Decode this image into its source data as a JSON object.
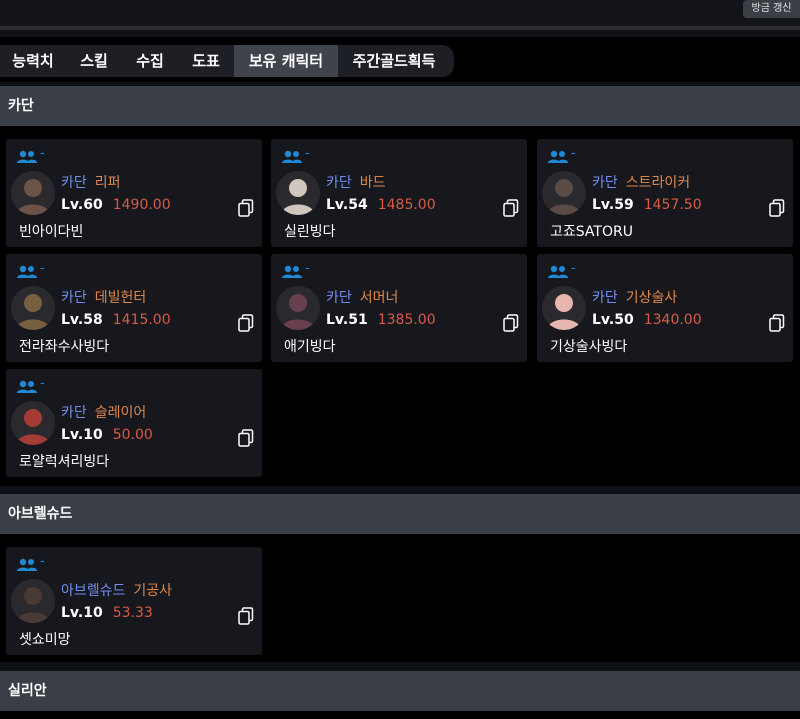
{
  "header": {
    "refresh_label": "방금 갱신"
  },
  "tabs": [
    {
      "label": "능력치",
      "active": false
    },
    {
      "label": "스킬",
      "active": false
    },
    {
      "label": "수집",
      "active": false
    },
    {
      "label": "도표",
      "active": false
    },
    {
      "label": "보유 캐릭터",
      "active": true
    },
    {
      "label": "주간골드획득",
      "active": false
    }
  ],
  "colors": {
    "server": "#6f8df0",
    "class": "#e0874a",
    "item_level": "#d85a45",
    "accent_blue": "#1e8ad6"
  },
  "sections": [
    {
      "title": "카단",
      "characters": [
        {
          "group": "-",
          "server": "카단",
          "class": "리퍼",
          "level": "Lv.60",
          "item_level": "1490.00",
          "name": "빈아이다빈",
          "avatar_color": "#6b5348"
        },
        {
          "group": "-",
          "server": "카단",
          "class": "바드",
          "level": "Lv.54",
          "item_level": "1485.00",
          "name": "실린빙다",
          "avatar_color": "#cfc7bd"
        },
        {
          "group": "-",
          "server": "카단",
          "class": "스트라이커",
          "level": "Lv.59",
          "item_level": "1457.50",
          "name": "고죠SATORU",
          "avatar_color": "#5c4b45"
        },
        {
          "group": "-",
          "server": "카단",
          "class": "데빌헌터",
          "level": "Lv.58",
          "item_level": "1415.00",
          "name": "전라좌수사빙다",
          "avatar_color": "#77603f"
        },
        {
          "group": "-",
          "server": "카단",
          "class": "서머너",
          "level": "Lv.51",
          "item_level": "1385.00",
          "name": "애기빙다",
          "avatar_color": "#6a4050"
        },
        {
          "group": "-",
          "server": "카단",
          "class": "기상술사",
          "level": "Lv.50",
          "item_level": "1340.00",
          "name": "기상술사빙다",
          "avatar_color": "#e7b6ae"
        },
        {
          "group": "-",
          "server": "카단",
          "class": "슬레이어",
          "level": "Lv.10",
          "item_level": "50.00",
          "name": "로얄럭셔리빙다",
          "avatar_color": "#a53b35"
        }
      ]
    },
    {
      "title": "아브렐슈드",
      "characters": [
        {
          "group": "-",
          "server": "아브렐슈드",
          "class": "기공사",
          "level": "Lv.10",
          "item_level": "53.33",
          "name": "셋쇼미망",
          "avatar_color": "#4a3a36"
        }
      ]
    },
    {
      "title": "실리안",
      "characters": []
    }
  ]
}
